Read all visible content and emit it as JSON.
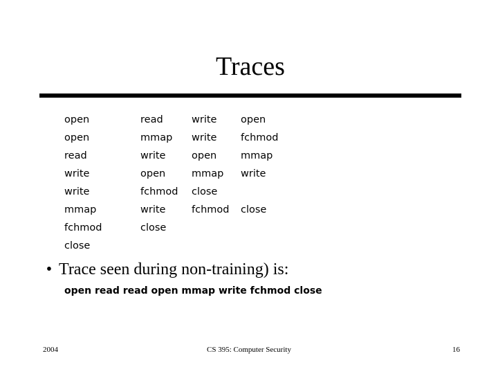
{
  "slide": {
    "title": "Traces",
    "footer": {
      "year": "2004",
      "course": "CS 395: Computer Security",
      "page_number": "16"
    }
  },
  "trace_table": {
    "columns": [
      {
        "name": "column-1",
        "cells": [
          "open",
          "open",
          "read",
          "write",
          "write",
          "mmap",
          "fchmod",
          "close"
        ]
      },
      {
        "name": "column-2",
        "cells": [
          "read",
          "mmap",
          "write",
          "open",
          "fchmod",
          "write",
          "close",
          ""
        ]
      },
      {
        "name": "column-3",
        "cells": [
          "write",
          "write",
          "open",
          "mmap",
          "close",
          "fchmod",
          "",
          ""
        ]
      },
      {
        "name": "column-4",
        "cells": [
          "open",
          "fchmod",
          "mmap",
          "write",
          "",
          "close",
          "",
          ""
        ]
      }
    ]
  },
  "bullet": {
    "marker": "•",
    "text": "Trace seen during non-training) is:"
  },
  "trace_result": {
    "text": "open read read open mmap write fchmod close"
  },
  "colors": {
    "background": "#ffffff",
    "text": "#000000",
    "rule": "#000000"
  }
}
